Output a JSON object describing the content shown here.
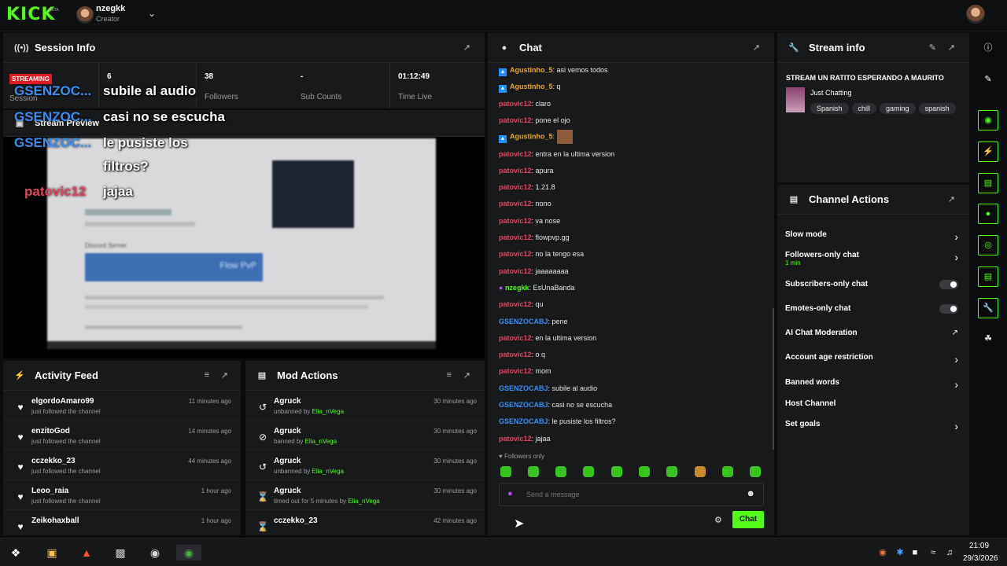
{
  "header": {
    "username": "nzegkk",
    "role": "Creator"
  },
  "session": {
    "title": "Session Info",
    "live_badge": "STREAMING",
    "stats": [
      {
        "value": "6",
        "label": "Session"
      },
      {
        "value": "38",
        "label": "Followers"
      },
      {
        "value": "-",
        "label": "Sub Counts"
      },
      {
        "value": "01:12:49",
        "label": "Time Live"
      }
    ],
    "preview_title": "Stream Preview",
    "overlay_messages": [
      {
        "user": "GSENZOC...",
        "text": "subile al audio"
      },
      {
        "user": "GSENZOC...",
        "text": "casi no se escucha"
      },
      {
        "user": "GSENZOC...",
        "text": "le pusiste los"
      },
      {
        "user": "",
        "text": "filtros?"
      },
      {
        "user": "patovic12",
        "text": "jajaa"
      }
    ],
    "preview_text": {
      "discord": "Discord Server",
      "flow": "Flow PvP"
    }
  },
  "activity": {
    "title": "Activity Feed",
    "items": [
      {
        "name": "elgordoAmaro99",
        "sub": "just followed the channel",
        "time": "11 minutes ago"
      },
      {
        "name": "enzitoGod",
        "sub": "just followed the channel",
        "time": "14 minutes ago"
      },
      {
        "name": "cczekko_23",
        "sub": "just followed the channel",
        "time": "44 minutes ago"
      },
      {
        "name": "Leoo_raia",
        "sub": "just followed the channel",
        "time": "1 hour ago"
      },
      {
        "name": "Zeikohaxball",
        "sub": "",
        "time": "1 hour ago"
      }
    ]
  },
  "mod": {
    "title": "Mod Actions",
    "items": [
      {
        "name": "Agruck",
        "action": "unbanned by ",
        "by": "Elia_nVega",
        "time": "30 minutes ago",
        "icon": "undo-icon"
      },
      {
        "name": "Agruck",
        "action": "banned by ",
        "by": "Elia_nVega",
        "time": "30 minutes ago",
        "icon": "ban-icon"
      },
      {
        "name": "Agruck",
        "action": "unbanned by ",
        "by": "Elia_nVega",
        "time": "30 minutes ago",
        "icon": "undo-icon"
      },
      {
        "name": "Agruck",
        "action": "timed out for 5 minutes by ",
        "by": "Elia_nVega",
        "time": "30 minutes ago",
        "icon": "hourglass-icon"
      },
      {
        "name": "cczekko_23",
        "action": "",
        "by": "",
        "time": "42 minutes ago",
        "icon": "hourglass-icon"
      }
    ]
  },
  "chat": {
    "title": "Chat",
    "messages": [
      {
        "user": "Agustinho_5",
        "text": "asi vemos todos",
        "color": "#e7a72c",
        "badge": true
      },
      {
        "user": "Agustinho_5",
        "text": "q",
        "color": "#e7a72c",
        "badge": true
      },
      {
        "user": "patovic12",
        "text": "claro",
        "color": "#e0455a"
      },
      {
        "user": "patovic12",
        "text": "pone el ojo",
        "color": "#e0455a"
      },
      {
        "user": "Agustinho_5",
        "text": "",
        "color": "#e7a72c",
        "badge": true,
        "emote": true
      },
      {
        "user": "patovic12",
        "text": "entra en la ultima version",
        "color": "#e0455a"
      },
      {
        "user": "patovic12",
        "text": "apura",
        "color": "#e0455a"
      },
      {
        "user": "patovic12",
        "text": "1.21.8",
        "color": "#e0455a"
      },
      {
        "user": "patovic12",
        "text": "nono",
        "color": "#e0455a"
      },
      {
        "user": "patovic12",
        "text": "va nose",
        "color": "#e0455a"
      },
      {
        "user": "patovic12",
        "text": "flowpvp.gg",
        "color": "#e0455a"
      },
      {
        "user": "patovic12",
        "text": "no la tengo esa",
        "color": "#e0455a"
      },
      {
        "user": "patovic12",
        "text": "jaaaaaaaa",
        "color": "#e0455a"
      },
      {
        "user": "nzegkk",
        "text": "EsUnaBanda",
        "color": "#53fc18",
        "mic": true
      },
      {
        "user": "patovic12",
        "text": "qu",
        "color": "#e0455a"
      },
      {
        "user": "GSENZOCABJ",
        "text": "pene",
        "color": "#3b8ef0"
      },
      {
        "user": "patovic12",
        "text": "en la ultima version",
        "color": "#e0455a"
      },
      {
        "user": "patovic12",
        "text": "o q",
        "color": "#e0455a"
      },
      {
        "user": "patovic12",
        "text": "mom",
        "color": "#e0455a"
      },
      {
        "user": "GSENZOCABJ",
        "text": "subile al audio",
        "color": "#3b8ef0"
      },
      {
        "user": "GSENZOCABJ",
        "text": "casi no se escucha",
        "color": "#3b8ef0"
      },
      {
        "user": "GSENZOCABJ",
        "text": "le pusiste los filtros?",
        "color": "#3b8ef0"
      },
      {
        "user": "patovic12",
        "text": "jajaa",
        "color": "#e0455a"
      }
    ],
    "followers_only": "Followers only",
    "placeholder": "Send a message",
    "send_label": "Chat"
  },
  "stream_info": {
    "title": "Stream info",
    "stream_title": "STREAM UN RATITO ESPERANDO A MAURITO",
    "category": "Just Chatting",
    "tags": [
      "Spanish",
      "chill",
      "gaming",
      "spanish"
    ]
  },
  "channel_actions": {
    "title": "Channel Actions",
    "items": [
      {
        "label": "Slow mode",
        "control": "chevron"
      },
      {
        "label": "Followers-only chat",
        "sub": "1 min",
        "control": "chevron"
      },
      {
        "label": "Subscribers-only chat",
        "control": "toggle"
      },
      {
        "label": "Emotes-only chat",
        "control": "toggle"
      },
      {
        "label": "AI Chat Moderation",
        "control": "external"
      },
      {
        "label": "Account age restriction",
        "control": "chevron"
      },
      {
        "label": "Banned words",
        "control": "chevron"
      },
      {
        "label": "Host Channel",
        "control": "none"
      },
      {
        "label": "Set goals",
        "control": "chevron"
      }
    ]
  },
  "taskbar": {
    "time": "21:09",
    "date": "29/3/2026"
  },
  "colors": {
    "accent": "#53fc18",
    "live": "#e01b24",
    "panel": "#18191b"
  }
}
